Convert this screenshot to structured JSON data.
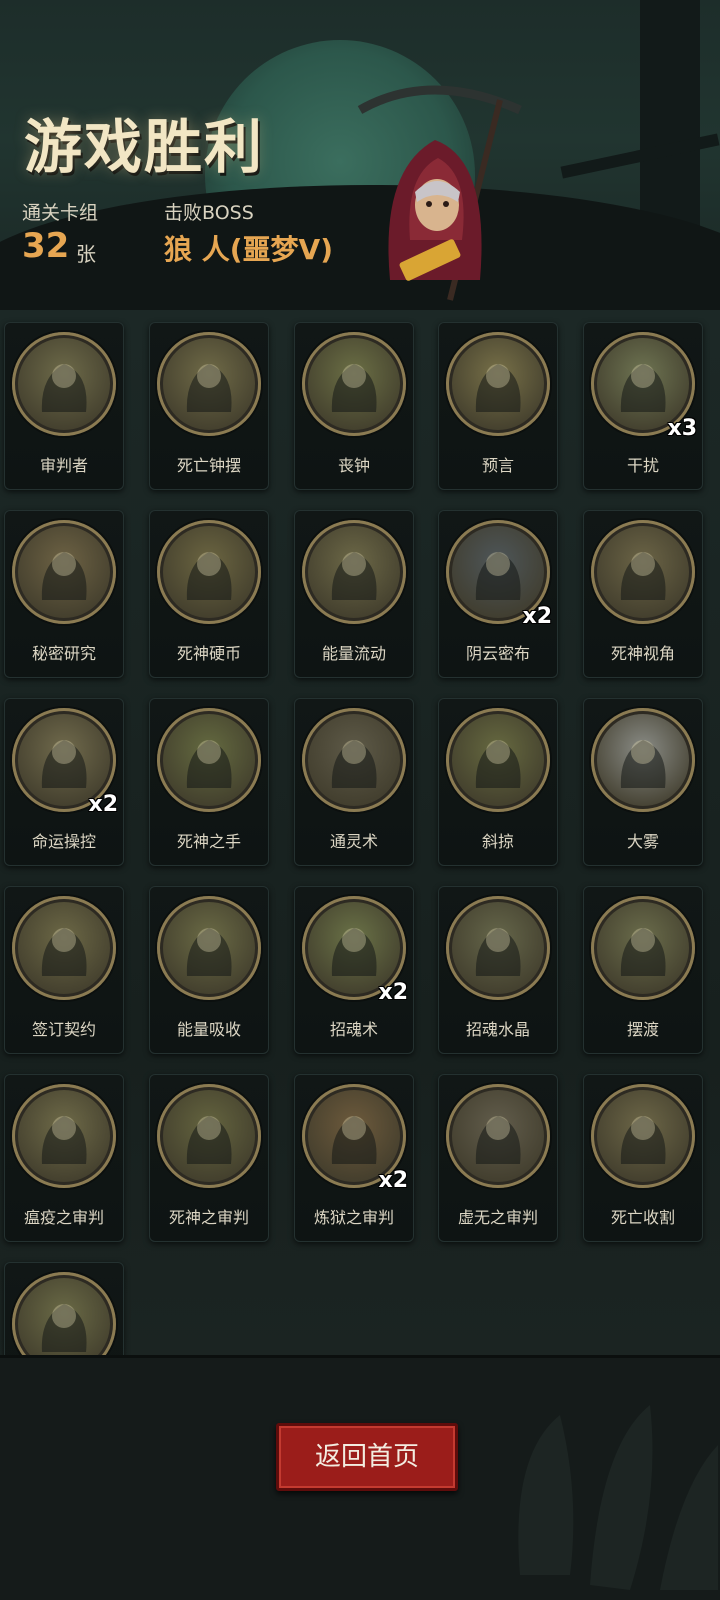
{
  "header": {
    "title": "游戏胜利",
    "deck_label": "通关卡组",
    "deck_count": "32",
    "deck_unit": "张",
    "boss_label": "击败BOSS",
    "boss_name": "狼 人(噩梦V)"
  },
  "cards": [
    {
      "name": "审判者",
      "count": "",
      "icon": "scythe-icon",
      "tint": "#6d6a49"
    },
    {
      "name": "死亡钟摆",
      "count": "",
      "icon": "pendulum-icon",
      "tint": "#6f6a47"
    },
    {
      "name": "丧钟",
      "count": "",
      "icon": "bell-icon",
      "tint": "#6b6f45"
    },
    {
      "name": "预言",
      "count": "",
      "icon": "sage-icon",
      "tint": "#777048"
    },
    {
      "name": "干扰",
      "count": "x3",
      "icon": "horn-icon",
      "tint": "#6e7452"
    },
    {
      "name": "秘密研究",
      "count": "",
      "icon": "scholar-icon",
      "tint": "#6d6244"
    },
    {
      "name": "死神硬币",
      "count": "",
      "icon": "coin-icon",
      "tint": "#6b6541"
    },
    {
      "name": "能量流动",
      "count": "",
      "icon": "energy-flow-icon",
      "tint": "#6c6847"
    },
    {
      "name": "阴云密布",
      "count": "x2",
      "icon": "storm-cloud-icon",
      "tint": "#4e5659"
    },
    {
      "name": "死神视角",
      "count": "",
      "icon": "reaper-view-icon",
      "tint": "#6b6446"
    },
    {
      "name": "命运操控",
      "count": "x2",
      "icon": "puppet-hand-icon",
      "tint": "#706a4c"
    },
    {
      "name": "死神之手",
      "count": "",
      "icon": "skull-hand-icon",
      "tint": "#646a40"
    },
    {
      "name": "通灵术",
      "count": "",
      "icon": "necromancy-icon",
      "tint": "#5e5a48"
    },
    {
      "name": "斜掠",
      "count": "",
      "icon": "slash-icon",
      "tint": "#666940"
    },
    {
      "name": "大雾",
      "count": "",
      "icon": "fog-icon",
      "tint": "#8a8c86"
    },
    {
      "name": "签订契约",
      "count": "",
      "icon": "contract-icon",
      "tint": "#6c6846"
    },
    {
      "name": "能量吸收",
      "count": "",
      "icon": "absorb-icon",
      "tint": "#6a6a45"
    },
    {
      "name": "招魂术",
      "count": "x2",
      "icon": "summon-icon",
      "tint": "#6a7247"
    },
    {
      "name": "招魂水晶",
      "count": "",
      "icon": "crystal-icon",
      "tint": "#65664a"
    },
    {
      "name": "摆渡",
      "count": "",
      "icon": "ferry-icon",
      "tint": "#6a6c4b"
    },
    {
      "name": "瘟疫之审判",
      "count": "",
      "icon": "plague-icon",
      "tint": "#6e6a48"
    },
    {
      "name": "死神之审判",
      "count": "",
      "icon": "reaper-icon",
      "tint": "#64643f"
    },
    {
      "name": "炼狱之审判",
      "count": "x2",
      "icon": "inferno-icon",
      "tint": "#6d5a3c"
    },
    {
      "name": "虚无之审判",
      "count": "",
      "icon": "void-icon",
      "tint": "#625d4c"
    },
    {
      "name": "死亡收割",
      "count": "",
      "icon": "harvest-icon",
      "tint": "#6c6647"
    },
    {
      "name": "",
      "count": "",
      "icon": "scythe-girl-icon",
      "tint": "#6a6a46"
    }
  ],
  "footer": {
    "home_button": "返回首页"
  }
}
